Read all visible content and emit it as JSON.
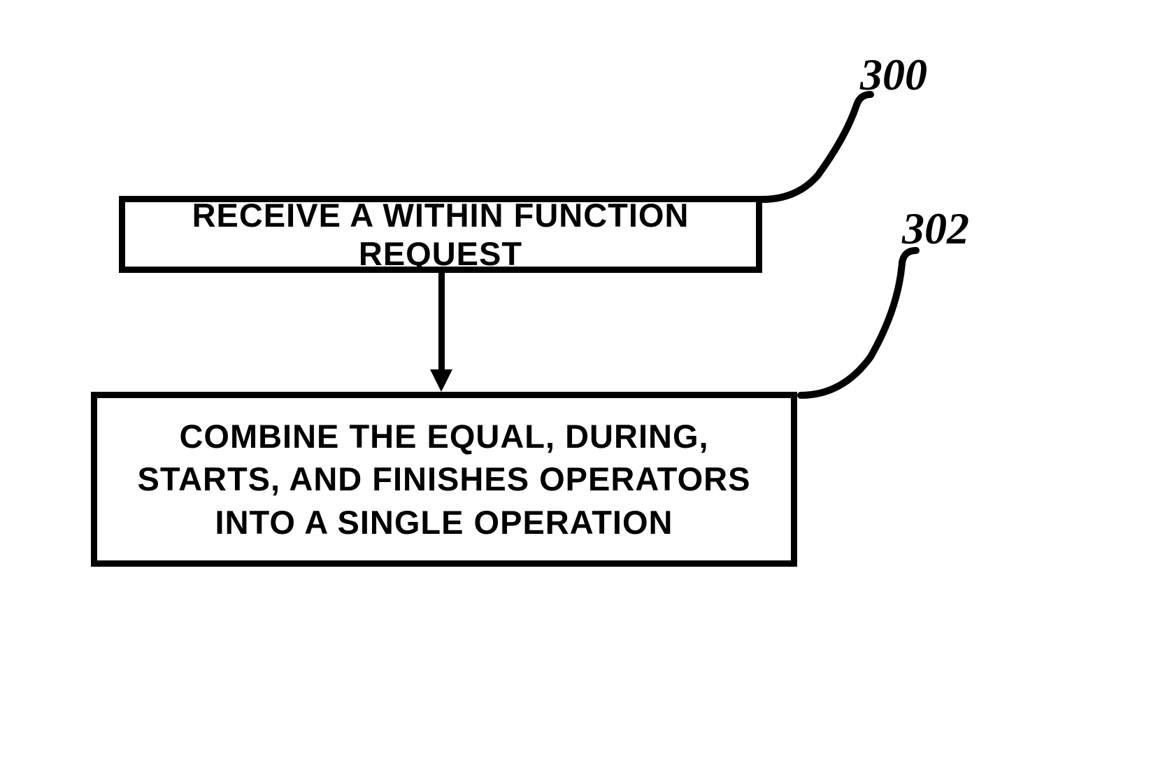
{
  "flowchart": {
    "boxes": {
      "step1": {
        "text": "RECEIVE A WITHIN FUNCTION REQUEST",
        "ref": "300"
      },
      "step2": {
        "text": "COMBINE THE EQUAL, DURING, STARTS, AND FINISHES OPERATORS INTO A SINGLE OPERATION",
        "ref": "302"
      }
    },
    "labels": {
      "ref300": "300",
      "ref302": "302"
    }
  }
}
